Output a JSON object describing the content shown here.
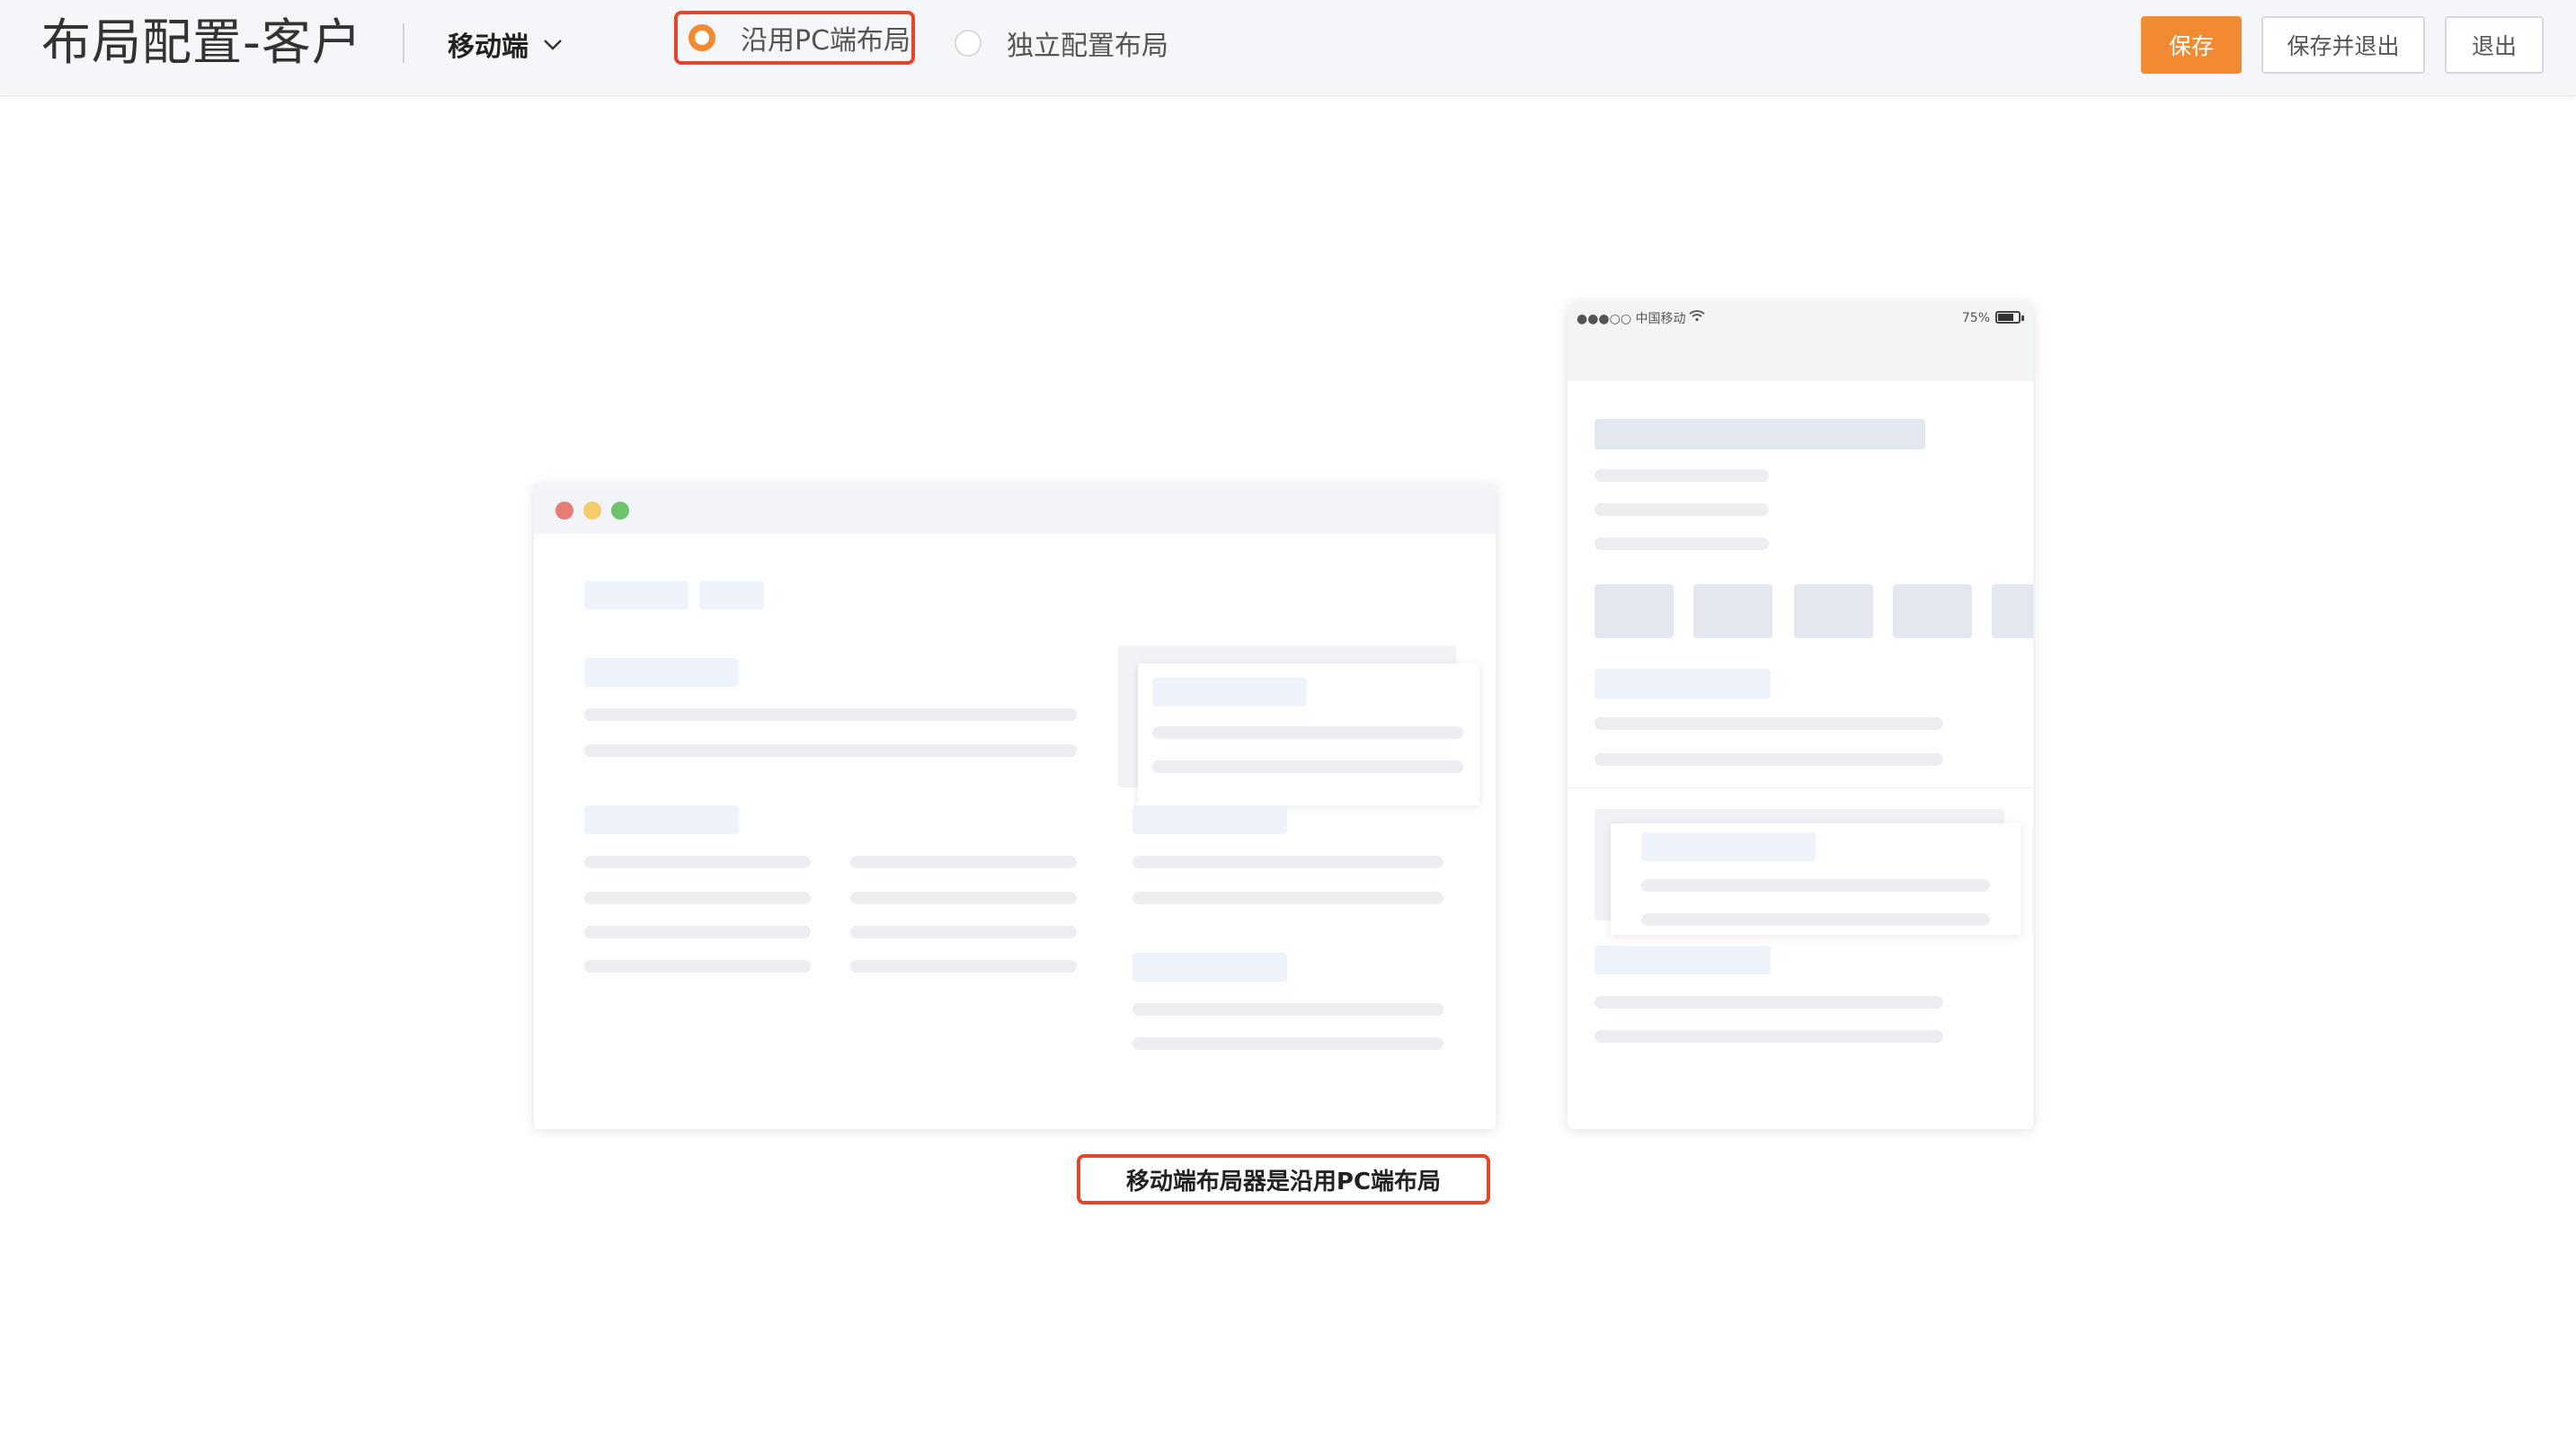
{
  "header": {
    "title": "布局配置-客户",
    "device_select": {
      "label": "移动端",
      "icon": "chevron-down-icon"
    },
    "layout_options": [
      {
        "label": "沿用PC端布局",
        "checked": true
      },
      {
        "label": "独立配置布局",
        "checked": false
      }
    ],
    "buttons": {
      "save": "保存",
      "save_exit": "保存并退出",
      "exit": "退出"
    }
  },
  "phone_preview": {
    "carrier": "●●●○○ 中国移动",
    "battery": "75%",
    "battery_level": 0.75
  },
  "caption": "移动端布局器是沿用PC端布局",
  "colors": {
    "accent": "#f08a33",
    "highlight_border": "#e0472b",
    "window_dots": [
      "#e67c73",
      "#f4cc6a",
      "#6cc46a"
    ]
  }
}
